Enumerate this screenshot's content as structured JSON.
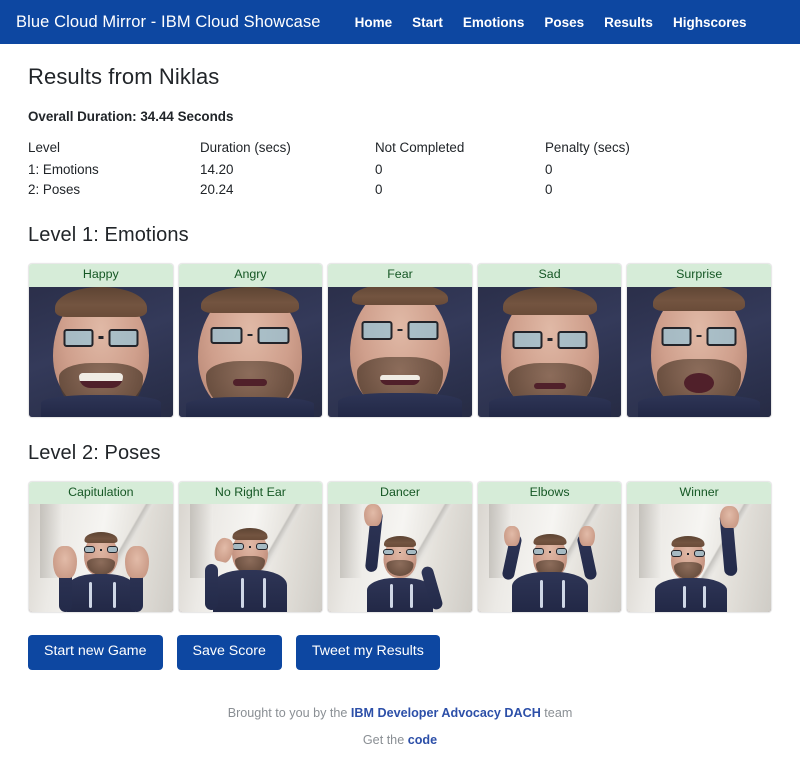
{
  "navbar": {
    "brand": "Blue Cloud Mirror - IBM Cloud Showcase",
    "brand_color": "#0d47a1",
    "links": [
      {
        "label": "Home"
      },
      {
        "label": "Start"
      },
      {
        "label": "Emotions"
      },
      {
        "label": "Poses"
      },
      {
        "label": "Results"
      },
      {
        "label": "Highscores"
      }
    ]
  },
  "main": {
    "page_title": "Results from Niklas",
    "overall_duration": "Overall Duration: 34.44 Seconds",
    "table": {
      "headers": [
        "Level",
        "Duration (secs)",
        "Not Completed",
        "Penalty (secs)"
      ],
      "rows": [
        {
          "level": "1: Emotions",
          "duration": "14.20",
          "not_completed": "0",
          "penalty": "0"
        },
        {
          "level": "2: Poses",
          "duration": "20.24",
          "not_completed": "0",
          "penalty": "0"
        }
      ]
    },
    "level1": {
      "heading": "Level 1: Emotions",
      "cards": [
        {
          "label": "Happy"
        },
        {
          "label": "Angry"
        },
        {
          "label": "Fear"
        },
        {
          "label": "Sad"
        },
        {
          "label": "Surprise"
        }
      ]
    },
    "level2": {
      "heading": "Level 2: Poses",
      "cards": [
        {
          "label": "Capitulation"
        },
        {
          "label": "No Right Ear"
        },
        {
          "label": "Dancer"
        },
        {
          "label": "Elbows"
        },
        {
          "label": "Winner"
        }
      ]
    },
    "buttons": [
      {
        "label": "Start new Game"
      },
      {
        "label": "Save Score"
      },
      {
        "label": "Tweet my Results"
      }
    ]
  },
  "footer": {
    "line1_prefix": "Brought to you by the ",
    "line1_link": "IBM Developer Advocacy DACH",
    "line1_suffix": " team",
    "line2_prefix": "Get the ",
    "line2_link": "code"
  },
  "theme": {
    "primary": "#0d47a1",
    "card_header_bg": "#d6ecd8",
    "card_header_text": "#155724",
    "link": "#2c4fa8"
  }
}
